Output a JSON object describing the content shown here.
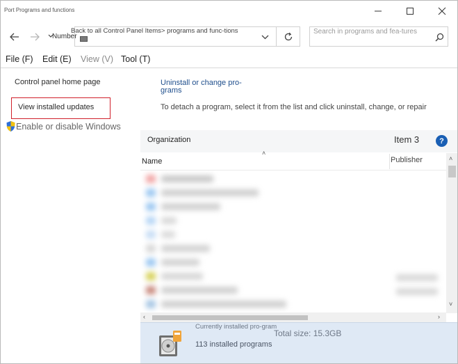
{
  "window": {
    "title": "Port Programs and functions"
  },
  "nav": {
    "number_label": "Number",
    "address": "Back to all Control Panel Items> programs and func-tions",
    "search_placeholder": "Search in programs and fea-tures"
  },
  "menu": [
    {
      "label": "File (F)",
      "enabled": true
    },
    {
      "label": "Edit (E)",
      "enabled": true
    },
    {
      "label": "View (V)",
      "enabled": false
    },
    {
      "label": "Tool (T)",
      "enabled": true
    }
  ],
  "left_pane": {
    "home_link": "Control panel home page",
    "updates_link": "View installed updates",
    "windows_features_link": "Enable or disable Windows"
  },
  "right_pane": {
    "title": "Uninstall or change pro-grams",
    "description": "To detach a program, select it from the list and click uninstall, change, or repair",
    "toolbar": {
      "organize": "Organization",
      "item_label": "Item 3",
      "help": "?"
    },
    "columns": {
      "name": "Name",
      "publisher": "Publisher"
    }
  },
  "details": {
    "currently_installed_label": "Currently installed pro-gram",
    "total_size": "Total size: 15.3GB",
    "installed_count": "113 installed programs"
  },
  "colors": {
    "link_blue": "#1e4e8c",
    "highlight_red": "#d01f2a",
    "details_bg": "#dfe9f5",
    "help_blue": "#1a5fb4"
  },
  "icons": [
    "back-arrow-icon",
    "forward-arrow-icon",
    "chevron-down-icon",
    "refresh-icon",
    "search-icon",
    "minimize-icon",
    "maximize-icon",
    "close-icon",
    "shield-icon",
    "help-icon",
    "programs-disc-icon"
  ]
}
